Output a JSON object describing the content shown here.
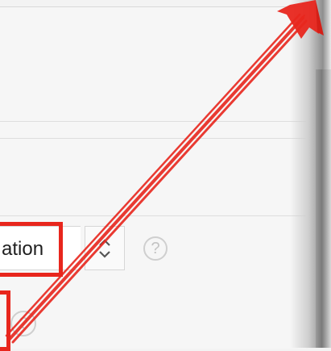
{
  "settings": {
    "select_value": "ation",
    "help_symbol": "?"
  },
  "annotation": {
    "color": "#e8261d"
  }
}
